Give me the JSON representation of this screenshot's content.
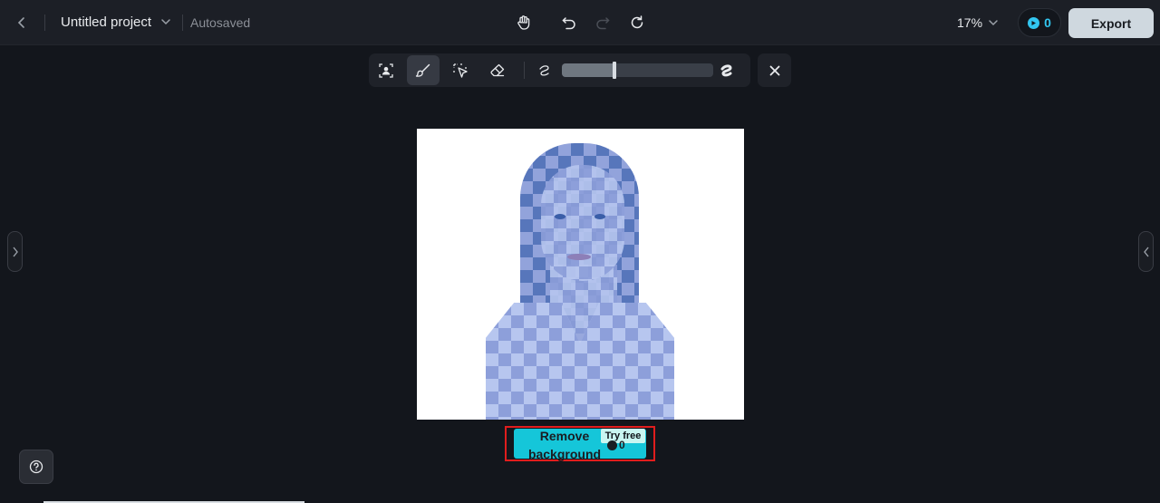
{
  "topbar": {
    "back_icon": "chevron-left-icon",
    "project_title": "Untitled project",
    "title_dropdown_icon": "chevron-down-icon",
    "save_status": "Autosaved",
    "tools": [
      "hand-icon",
      "undo-icon",
      "redo-icon",
      "refresh-icon"
    ],
    "zoom": "17%",
    "zoom_dropdown_icon": "chevron-down-icon",
    "credits": "0",
    "export_label": "Export"
  },
  "edit_toolbar": {
    "tools": [
      "person-select-icon",
      "brush-icon",
      "smart-select-icon",
      "eraser-icon"
    ],
    "active_tool": "brush-icon",
    "brush_size_small_icon": "brush-size-small-icon",
    "brush_size_large_icon": "brush-size-large-icon",
    "brush_size": 0.35,
    "close_icon": "close-icon"
  },
  "remove_bg": {
    "label": "Remove background",
    "badge": "Try free",
    "credit": "0"
  },
  "colors": {
    "accent": "#15c6d9",
    "highlight_frame": "#e11d1d",
    "mask": "#8d9fda",
    "background": "#13161c"
  },
  "help_icon": "help-icon"
}
